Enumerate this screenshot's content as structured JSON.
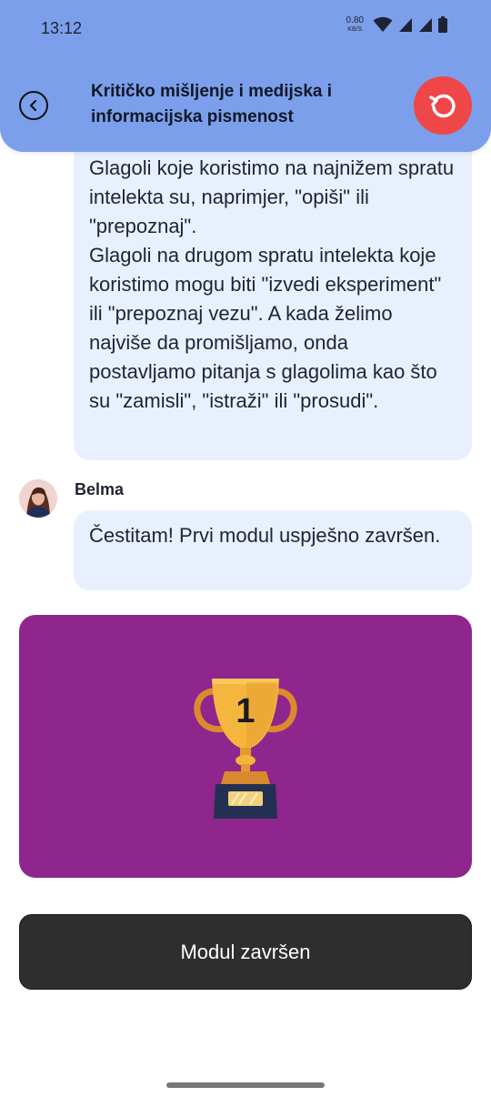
{
  "status_bar": {
    "time": "13:12",
    "net_speed_value": "0.80",
    "net_speed_unit": "KB/S",
    "icons": [
      "wifi-icon",
      "signal-icon",
      "signal-icon",
      "battery-icon"
    ]
  },
  "header": {
    "title_line1": "Kritičko mišljenje i medijska i",
    "title_line2": "informacijska pismenost",
    "back_icon": "chevron-left-icon",
    "restart_icon": "restart-icon",
    "background_color": "#7b9fea",
    "restart_color": "#ef4647"
  },
  "messages": [
    {
      "paragraphs": [
        "Glagoli koje koristimo na najnižem spratu intelekta su, naprimjer, \"opiši\" ili \"prepoznaj\".",
        "Glagoli na drugom spratu intelekta koje koristimo mogu biti \"izvedi eksperiment\" ili \"prepoznaj vezu\". A kada želimo najviše da promišljamo, onda postavljamo pitanja s glagolima kao što su \"zamisli\", \"istraži\" ili \"prosudi\"."
      ]
    },
    {
      "sender": "Belma",
      "text": "Čestitam! Prvi modul uspješno završen."
    }
  ],
  "trophy": {
    "number": "1",
    "card_color": "#8e268d"
  },
  "done_button": {
    "label": "Modul završen"
  }
}
